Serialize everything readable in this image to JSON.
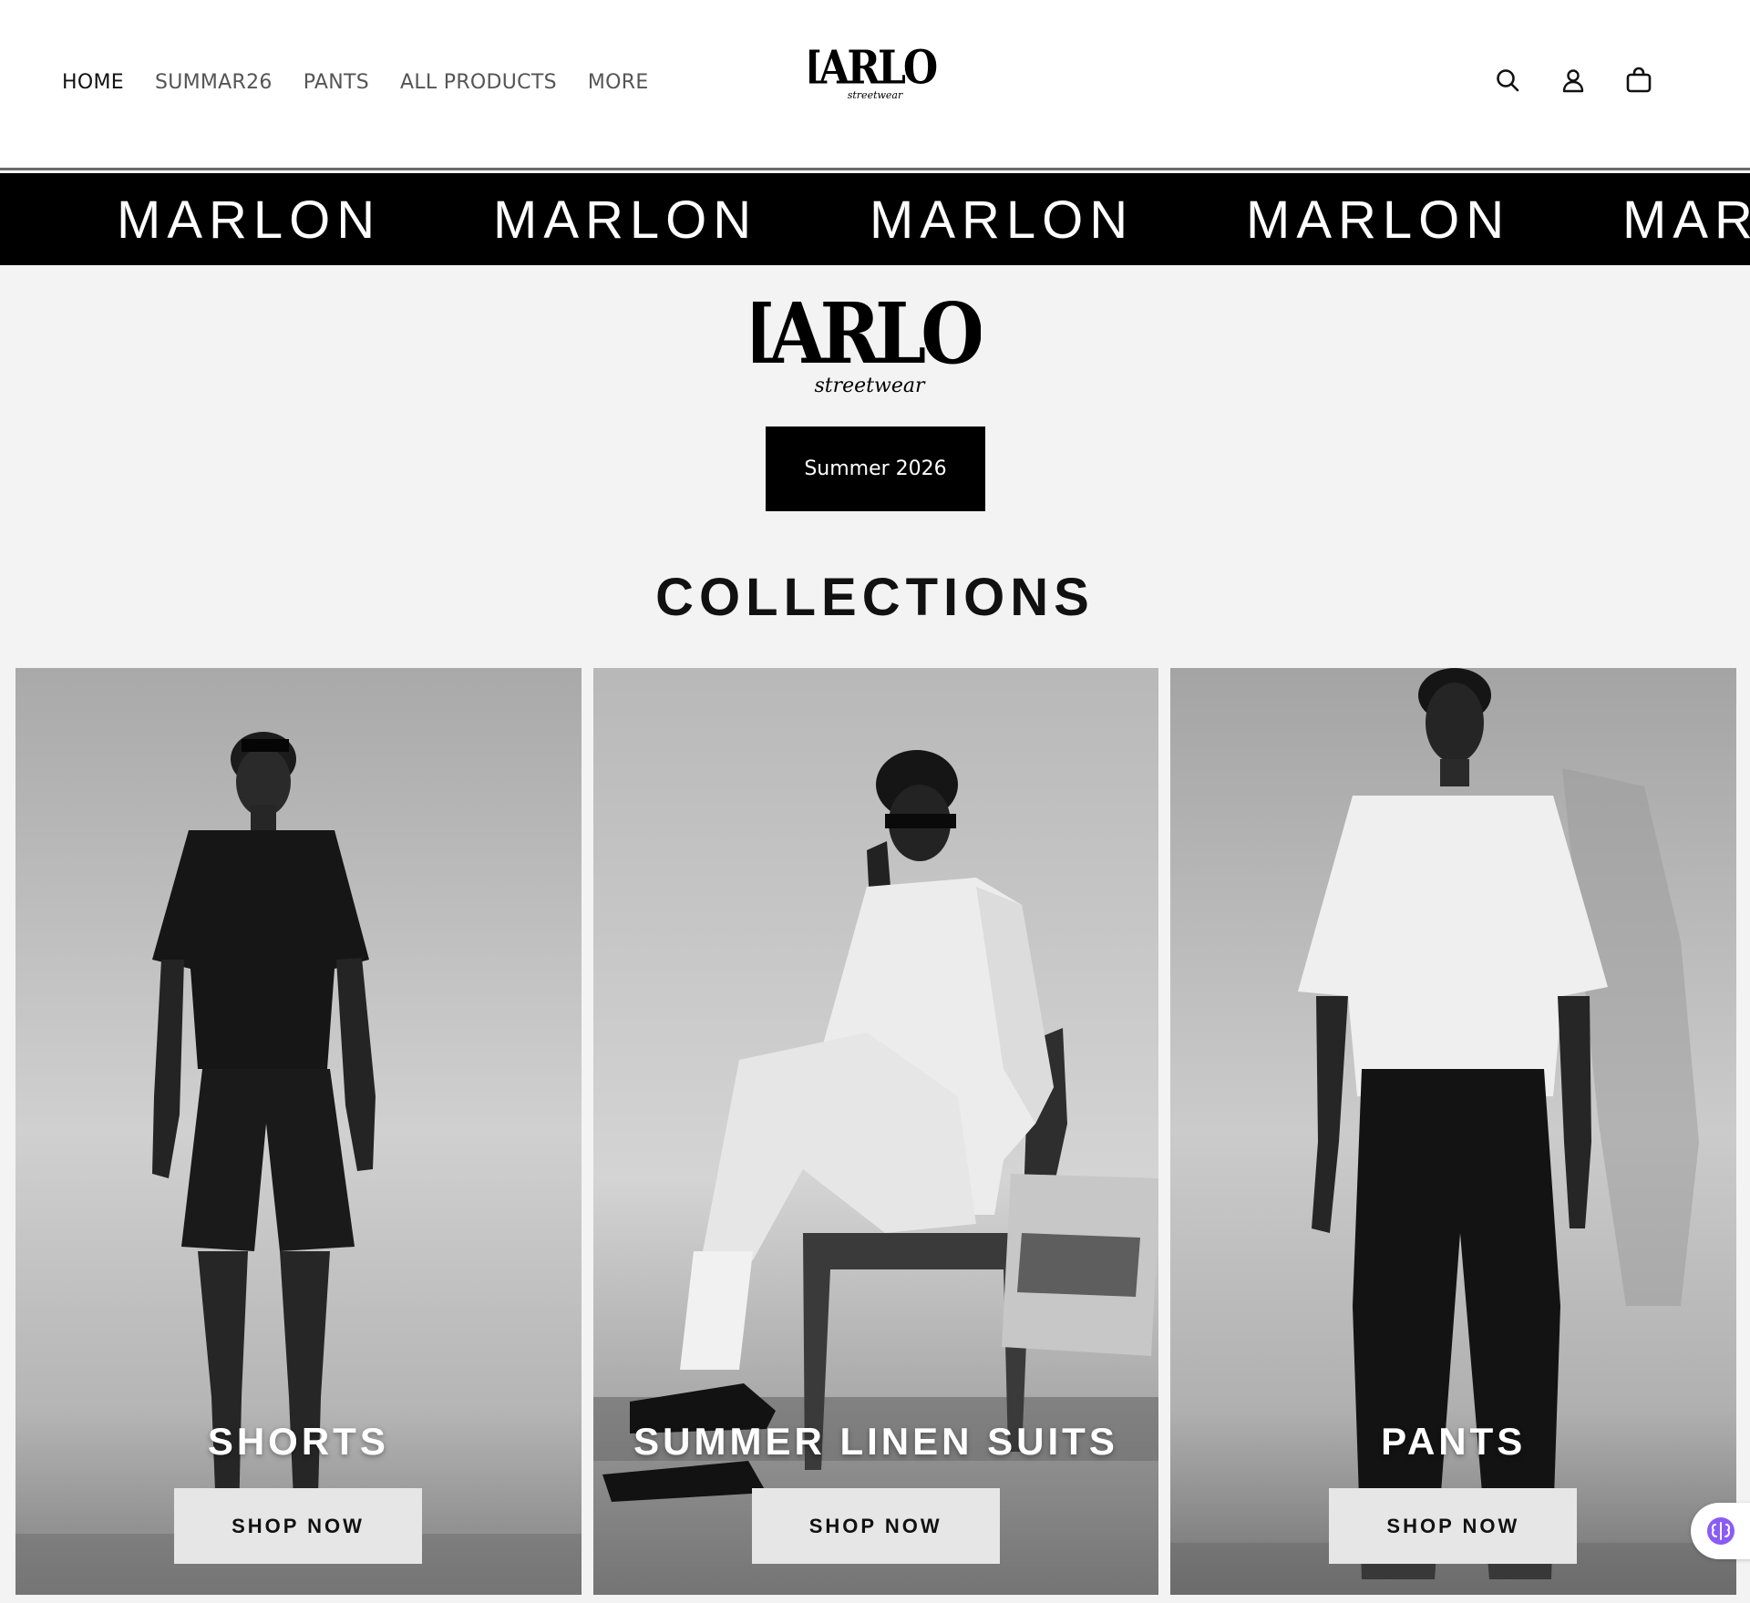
{
  "header": {
    "nav": [
      {
        "label": "HOME",
        "active": true
      },
      {
        "label": "SUMMAR26",
        "active": false
      },
      {
        "label": "PANTS",
        "active": false
      },
      {
        "label": "ALL PRODUCTS",
        "active": false
      },
      {
        "label": "MORE",
        "active": false
      }
    ],
    "logo_text": "MARLON",
    "logo_sub": "streetwear",
    "icons": [
      "search-icon",
      "account-icon",
      "cart-icon"
    ]
  },
  "marquee": {
    "items": [
      "MARLON",
      "MARLON",
      "MARLON",
      "MARLON",
      "MAR"
    ]
  },
  "hero": {
    "button_label": "Summer 2026"
  },
  "collections": {
    "title": "COLLECTIONS",
    "cards": [
      {
        "title": "SHORTS",
        "button": "SHOP NOW"
      },
      {
        "title": "SUMMER LINEN SUITS",
        "button": "SHOP NOW"
      },
      {
        "title": "PANTS",
        "button": "SHOP NOW"
      }
    ]
  },
  "colors": {
    "background": "#f3f3f3",
    "header_bg": "#ffffff",
    "marquee_bg": "#000000",
    "button_dark": "#000000",
    "button_light": "#e6e6e6",
    "chat_accent": "#8a5cf6"
  }
}
